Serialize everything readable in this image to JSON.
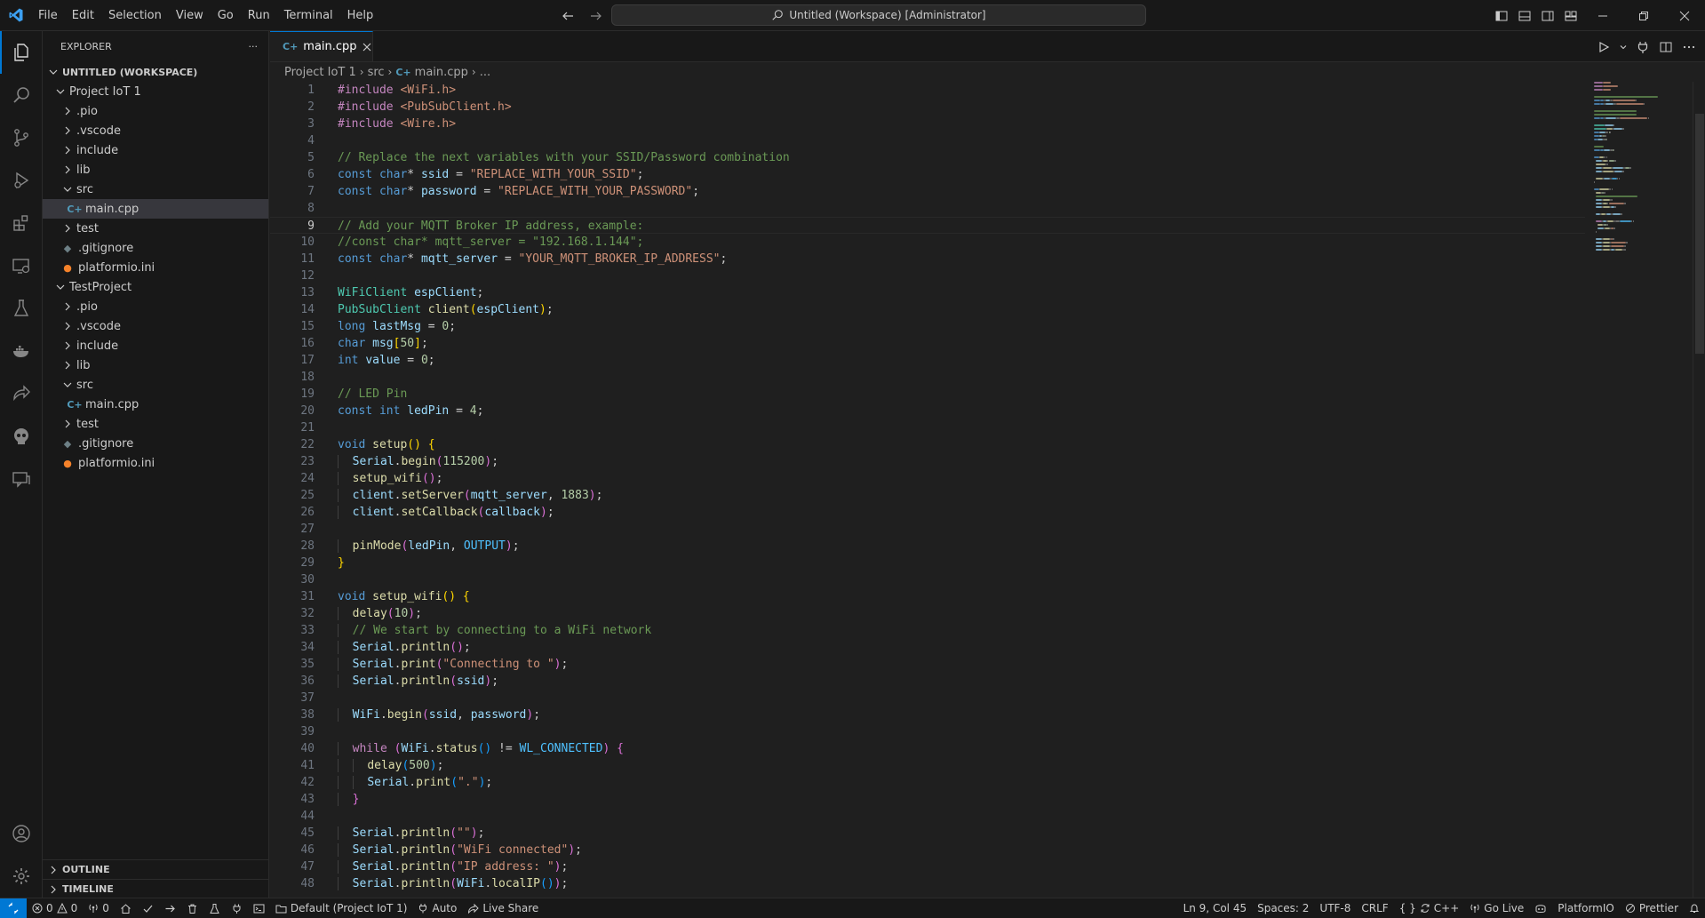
{
  "window": {
    "title": "Untitled (Workspace) [Administrator]",
    "menu": [
      "File",
      "Edit",
      "Selection",
      "View",
      "Go",
      "Run",
      "Terminal",
      "Help"
    ]
  },
  "sidebar": {
    "title": "EXPLORER",
    "more": "···",
    "workspace_label": "UNTITLED (WORKSPACE)",
    "tree": [
      {
        "label": "Project IoT 1",
        "depth": 1,
        "type": "folder",
        "open": true
      },
      {
        "label": ".pio",
        "depth": 2,
        "type": "folder",
        "open": false
      },
      {
        "label": ".vscode",
        "depth": 2,
        "type": "folder",
        "open": false
      },
      {
        "label": "include",
        "depth": 2,
        "type": "folder",
        "open": false
      },
      {
        "label": "lib",
        "depth": 2,
        "type": "folder",
        "open": false
      },
      {
        "label": "src",
        "depth": 2,
        "type": "folder",
        "open": true
      },
      {
        "label": "main.cpp",
        "depth": 3,
        "type": "cpp",
        "selected": true
      },
      {
        "label": "test",
        "depth": 2,
        "type": "folder",
        "open": false
      },
      {
        "label": ".gitignore",
        "depth": 2,
        "type": "git"
      },
      {
        "label": "platformio.ini",
        "depth": 2,
        "type": "pio"
      },
      {
        "label": "TestProject",
        "depth": 1,
        "type": "folder",
        "open": true
      },
      {
        "label": ".pio",
        "depth": 2,
        "type": "folder",
        "open": false
      },
      {
        "label": ".vscode",
        "depth": 2,
        "type": "folder",
        "open": false
      },
      {
        "label": "include",
        "depth": 2,
        "type": "folder",
        "open": false
      },
      {
        "label": "lib",
        "depth": 2,
        "type": "folder",
        "open": false
      },
      {
        "label": "src",
        "depth": 2,
        "type": "folder",
        "open": true
      },
      {
        "label": "main.cpp",
        "depth": 3,
        "type": "cpp"
      },
      {
        "label": "test",
        "depth": 2,
        "type": "folder",
        "open": false
      },
      {
        "label": ".gitignore",
        "depth": 2,
        "type": "git"
      },
      {
        "label": "platformio.ini",
        "depth": 2,
        "type": "pio"
      }
    ],
    "outline_label": "OUTLINE",
    "timeline_label": "TIMELINE"
  },
  "editor": {
    "tab_label": "main.cpp",
    "breadcrumbs": [
      "Project IoT 1",
      "src",
      "main.cpp",
      "..."
    ],
    "active_line": 9,
    "lines": [
      [
        [
          "#include ",
          "inc"
        ],
        [
          "<WiFi.h>",
          "str"
        ]
      ],
      [
        [
          "#include ",
          "inc"
        ],
        [
          "<PubSubClient.h>",
          "str"
        ]
      ],
      [
        [
          "#include ",
          "inc"
        ],
        [
          "<Wire.h>",
          "str"
        ]
      ],
      [],
      [
        [
          "// Replace the next variables with your SSID/Password combination",
          "cmt"
        ]
      ],
      [
        [
          "const ",
          "kw"
        ],
        [
          "char",
          "kw"
        ],
        [
          "* ",
          ""
        ],
        [
          "ssid",
          "var"
        ],
        [
          " = ",
          ""
        ],
        [
          "\"REPLACE_WITH_YOUR_SSID\"",
          "str"
        ],
        [
          ";",
          ""
        ]
      ],
      [
        [
          "const ",
          "kw"
        ],
        [
          "char",
          "kw"
        ],
        [
          "* ",
          ""
        ],
        [
          "password",
          "var"
        ],
        [
          " = ",
          ""
        ],
        [
          "\"REPLACE_WITH_YOUR_PASSWORD\"",
          "str"
        ],
        [
          ";",
          ""
        ]
      ],
      [],
      [
        [
          "// Add your MQTT Broker IP address, example:",
          "cmt"
        ]
      ],
      [
        [
          "//const char* mqtt_server = \"192.168.1.144\";",
          "cmt"
        ]
      ],
      [
        [
          "const ",
          "kw"
        ],
        [
          "char",
          "kw"
        ],
        [
          "* ",
          ""
        ],
        [
          "mqtt_server",
          "var"
        ],
        [
          " = ",
          ""
        ],
        [
          "\"YOUR_MQTT_BROKER_IP_ADDRESS\"",
          "str"
        ],
        [
          ";",
          ""
        ]
      ],
      [],
      [
        [
          "WiFiClient ",
          "typ"
        ],
        [
          "espClient",
          "var"
        ],
        [
          ";",
          ""
        ]
      ],
      [
        [
          "PubSubClient ",
          "typ"
        ],
        [
          "client",
          "fn"
        ],
        [
          "(",
          "br1"
        ],
        [
          "espClient",
          "var"
        ],
        [
          ")",
          "br1"
        ],
        [
          ";",
          ""
        ]
      ],
      [
        [
          "long ",
          "kw"
        ],
        [
          "lastMsg",
          "var"
        ],
        [
          " = ",
          ""
        ],
        [
          "0",
          "num"
        ],
        [
          ";",
          ""
        ]
      ],
      [
        [
          "char ",
          "kw"
        ],
        [
          "msg",
          "var"
        ],
        [
          "[",
          "br1"
        ],
        [
          "50",
          "num"
        ],
        [
          "]",
          "br1"
        ],
        [
          ";",
          ""
        ]
      ],
      [
        [
          "int ",
          "kw"
        ],
        [
          "value",
          "var"
        ],
        [
          " = ",
          ""
        ],
        [
          "0",
          "num"
        ],
        [
          ";",
          ""
        ]
      ],
      [],
      [
        [
          "// LED Pin",
          "cmt"
        ]
      ],
      [
        [
          "const ",
          "kw"
        ],
        [
          "int ",
          "kw"
        ],
        [
          "ledPin",
          "var"
        ],
        [
          " = ",
          ""
        ],
        [
          "4",
          "num"
        ],
        [
          ";",
          ""
        ]
      ],
      [],
      [
        [
          "void ",
          "kw"
        ],
        [
          "setup",
          "fn"
        ],
        [
          "()",
          "br1"
        ],
        [
          " ",
          ""
        ],
        [
          "{",
          "br1"
        ]
      ],
      [
        [
          "  ",
          "g"
        ],
        [
          "Serial",
          "var"
        ],
        [
          ".",
          ""
        ],
        [
          "begin",
          "fn"
        ],
        [
          "(",
          "br2"
        ],
        [
          "115200",
          "num"
        ],
        [
          ")",
          "br2"
        ],
        [
          ";",
          ""
        ]
      ],
      [
        [
          "  ",
          "g"
        ],
        [
          "setup_wifi",
          "fn"
        ],
        [
          "()",
          "br2"
        ],
        [
          ";",
          ""
        ]
      ],
      [
        [
          "  ",
          "g"
        ],
        [
          "client",
          "var"
        ],
        [
          ".",
          ""
        ],
        [
          "setServer",
          "fn"
        ],
        [
          "(",
          "br2"
        ],
        [
          "mqtt_server",
          "var"
        ],
        [
          ", ",
          ""
        ],
        [
          "1883",
          "num"
        ],
        [
          ")",
          "br2"
        ],
        [
          ";",
          ""
        ]
      ],
      [
        [
          "  ",
          "g"
        ],
        [
          "client",
          "var"
        ],
        [
          ".",
          ""
        ],
        [
          "setCallback",
          "fn"
        ],
        [
          "(",
          "br2"
        ],
        [
          "callback",
          "var"
        ],
        [
          ")",
          "br2"
        ],
        [
          ";",
          ""
        ]
      ],
      [],
      [
        [
          "  ",
          "g"
        ],
        [
          "pinMode",
          "fn"
        ],
        [
          "(",
          "br2"
        ],
        [
          "ledPin",
          "var"
        ],
        [
          ", ",
          ""
        ],
        [
          "OUTPUT",
          "con"
        ],
        [
          ")",
          "br2"
        ],
        [
          ";",
          ""
        ]
      ],
      [
        [
          "}",
          "br1"
        ]
      ],
      [],
      [
        [
          "void ",
          "kw"
        ],
        [
          "setup_wifi",
          "fn"
        ],
        [
          "()",
          "br1"
        ],
        [
          " ",
          ""
        ],
        [
          "{",
          "br1"
        ]
      ],
      [
        [
          "  ",
          "g"
        ],
        [
          "delay",
          "fn"
        ],
        [
          "(",
          "br2"
        ],
        [
          "10",
          "num"
        ],
        [
          ")",
          "br2"
        ],
        [
          ";",
          ""
        ]
      ],
      [
        [
          "  ",
          "g"
        ],
        [
          "// We start by connecting to a WiFi network",
          "cmt"
        ]
      ],
      [
        [
          "  ",
          "g"
        ],
        [
          "Serial",
          "var"
        ],
        [
          ".",
          ""
        ],
        [
          "println",
          "fn"
        ],
        [
          "()",
          "br2"
        ],
        [
          ";",
          ""
        ]
      ],
      [
        [
          "  ",
          "g"
        ],
        [
          "Serial",
          "var"
        ],
        [
          ".",
          ""
        ],
        [
          "print",
          "fn"
        ],
        [
          "(",
          "br2"
        ],
        [
          "\"Connecting to \"",
          "str"
        ],
        [
          ")",
          "br2"
        ],
        [
          ";",
          ""
        ]
      ],
      [
        [
          "  ",
          "g"
        ],
        [
          "Serial",
          "var"
        ],
        [
          ".",
          ""
        ],
        [
          "println",
          "fn"
        ],
        [
          "(",
          "br2"
        ],
        [
          "ssid",
          "var"
        ],
        [
          ")",
          "br2"
        ],
        [
          ";",
          ""
        ]
      ],
      [],
      [
        [
          "  ",
          "g"
        ],
        [
          "WiFi",
          "var"
        ],
        [
          ".",
          ""
        ],
        [
          "begin",
          "fn"
        ],
        [
          "(",
          "br2"
        ],
        [
          "ssid",
          "var"
        ],
        [
          ", ",
          ""
        ],
        [
          "password",
          "var"
        ],
        [
          ")",
          "br2"
        ],
        [
          ";",
          ""
        ]
      ],
      [],
      [
        [
          "  ",
          "g"
        ],
        [
          "while ",
          "inc"
        ],
        [
          "(",
          "br2"
        ],
        [
          "WiFi",
          "var"
        ],
        [
          ".",
          ""
        ],
        [
          "status",
          "fn"
        ],
        [
          "()",
          "br3"
        ],
        [
          " != ",
          ""
        ],
        [
          "WL_CONNECTED",
          "con"
        ],
        [
          ")",
          "br2"
        ],
        [
          " ",
          ""
        ],
        [
          "{",
          "br2"
        ]
      ],
      [
        [
          "  ",
          "g"
        ],
        [
          "  ",
          "g"
        ],
        [
          "delay",
          "fn"
        ],
        [
          "(",
          "br3"
        ],
        [
          "500",
          "num"
        ],
        [
          ")",
          "br3"
        ],
        [
          ";",
          ""
        ]
      ],
      [
        [
          "  ",
          "g"
        ],
        [
          "  ",
          "g"
        ],
        [
          "Serial",
          "var"
        ],
        [
          ".",
          ""
        ],
        [
          "print",
          "fn"
        ],
        [
          "(",
          "br3"
        ],
        [
          "\".\"",
          "str"
        ],
        [
          ")",
          "br3"
        ],
        [
          ";",
          ""
        ]
      ],
      [
        [
          "  ",
          "g"
        ],
        [
          "}",
          "br2"
        ]
      ],
      [],
      [
        [
          "  ",
          "g"
        ],
        [
          "Serial",
          "var"
        ],
        [
          ".",
          ""
        ],
        [
          "println",
          "fn"
        ],
        [
          "(",
          "br2"
        ],
        [
          "\"\"",
          "str"
        ],
        [
          ")",
          "br2"
        ],
        [
          ";",
          ""
        ]
      ],
      [
        [
          "  ",
          "g"
        ],
        [
          "Serial",
          "var"
        ],
        [
          ".",
          ""
        ],
        [
          "println",
          "fn"
        ],
        [
          "(",
          "br2"
        ],
        [
          "\"WiFi connected\"",
          "str"
        ],
        [
          ")",
          "br2"
        ],
        [
          ";",
          ""
        ]
      ],
      [
        [
          "  ",
          "g"
        ],
        [
          "Serial",
          "var"
        ],
        [
          ".",
          ""
        ],
        [
          "println",
          "fn"
        ],
        [
          "(",
          "br2"
        ],
        [
          "\"IP address: \"",
          "str"
        ],
        [
          ")",
          "br2"
        ],
        [
          ";",
          ""
        ]
      ],
      [
        [
          "  ",
          "g"
        ],
        [
          "Serial",
          "var"
        ],
        [
          ".",
          ""
        ],
        [
          "println",
          "fn"
        ],
        [
          "(",
          "br2"
        ],
        [
          "WiFi",
          "var"
        ],
        [
          ".",
          ""
        ],
        [
          "localIP",
          "fn"
        ],
        [
          "()",
          "br3"
        ],
        [
          ")",
          "br2"
        ],
        [
          ";",
          ""
        ]
      ]
    ]
  },
  "status": {
    "errors": "0",
    "warnings": "0",
    "ports": "0",
    "env": "Default (Project IoT 1)",
    "auto": "Auto",
    "live_share": "Live Share",
    "cursor": "Ln 9, Col 45",
    "spaces": "Spaces: 2",
    "encoding": "UTF-8",
    "eol": "CRLF",
    "braces": "{ }",
    "language": "C++",
    "go_live": "Go Live",
    "platformio": "PlatformIO",
    "prettier": "Prettier"
  },
  "colors": {
    "accent": "#0078d4",
    "background": "#1f1f1f",
    "chrome": "#181818",
    "cpp_icon": "#519aba",
    "pio_icon": "#f5822a"
  }
}
